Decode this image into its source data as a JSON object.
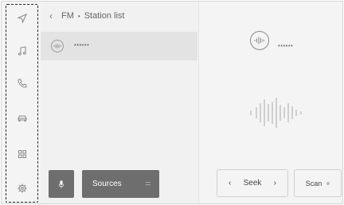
{
  "rail": {
    "items": [
      {
        "icon": "navigation-icon"
      },
      {
        "icon": "music-icon"
      },
      {
        "icon": "phone-icon"
      },
      {
        "icon": "car-icon"
      },
      {
        "icon": "apps-grid-icon"
      },
      {
        "icon": "settings-gear-icon"
      }
    ]
  },
  "header": {
    "back_glyph": "‹",
    "source": "FM",
    "separator": "•",
    "title": "Station list"
  },
  "stations": [
    {
      "name": "******"
    }
  ],
  "now_playing": {
    "station": "******"
  },
  "controls": {
    "sources_label": "Sources",
    "seek_label": "Seek",
    "seek_prev": "‹",
    "seek_next": "›",
    "scan_label": "Scan"
  },
  "colors": {
    "background": "#f4f4f4",
    "selected_row": "#e3e3e3",
    "button_dark": "#6e6e6e",
    "text": "#555555"
  }
}
